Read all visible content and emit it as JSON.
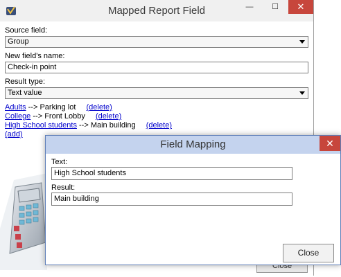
{
  "main_window": {
    "title": "Mapped Report Field",
    "controls": {
      "minimize": "—",
      "maximize": "☐",
      "close": "✕"
    },
    "source_field_label": "Source field:",
    "source_field_value": "Group",
    "new_name_label": "New field's name:",
    "new_name_value": "Check-in point",
    "result_type_label": "Result type:",
    "result_type_value": "Text value",
    "mappings": [
      {
        "source": "Adults",
        "arrow": "-->",
        "target": "Parking lot",
        "delete": "(delete)"
      },
      {
        "source": "College",
        "arrow": "-->",
        "target": "Front Lobby",
        "delete": "(delete)"
      },
      {
        "source": "High School students",
        "arrow": "-->",
        "target": "Main building",
        "delete": "(delete)"
      }
    ],
    "add_link": "(add)",
    "close_button": "Close"
  },
  "dialog": {
    "title": "Field Mapping",
    "close_glyph": "✕",
    "text_label": "Text:",
    "text_value": "High School students",
    "result_label": "Result:",
    "result_value": "Main building",
    "close_button": "Close"
  },
  "colors": {
    "link": "#0000cc",
    "dialog_title_bg": "#c4d3ee",
    "close_red": "#c7463c"
  }
}
